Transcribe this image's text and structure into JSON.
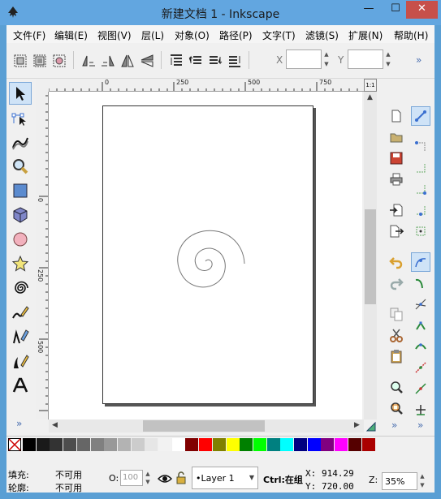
{
  "window": {
    "title": "新建文档 1 - Inkscape",
    "minimize": "—",
    "maximize": "☐",
    "close": "✕"
  },
  "menu": [
    {
      "label": "文件(F)"
    },
    {
      "label": "编辑(E)"
    },
    {
      "label": "视图(V)"
    },
    {
      "label": "层(L)"
    },
    {
      "label": "对象(O)"
    },
    {
      "label": "路径(P)"
    },
    {
      "label": "文字(T)"
    },
    {
      "label": "滤镜(S)"
    },
    {
      "label": "扩展(N)"
    },
    {
      "label": "帮助(H)"
    }
  ],
  "commands": {
    "x_label": "X",
    "y_label": "Y",
    "x_value": "",
    "y_value": "",
    "more": "»"
  },
  "ruler": {
    "top_ticks": [
      "0",
      "250",
      "500",
      "750"
    ],
    "left_ticks": [
      "0",
      "250",
      "500"
    ]
  },
  "zoom_corner": "1:1",
  "statusbar": {
    "fill_label": "填充:",
    "fill_value": "不可用",
    "stroke_label": "轮廓:",
    "stroke_value": "不可用",
    "opacity_label": "O:",
    "opacity_value": "100",
    "layer": "•Layer 1",
    "message": "Ctrl:在组",
    "x_label": "X:",
    "x_value": "914.29",
    "y_label": "Y:",
    "y_value": "720.00",
    "zoom_label": "Z:",
    "zoom_value": "35%"
  },
  "palette": [
    "#000000",
    "#1a1a1a",
    "#333333",
    "#4d4d4d",
    "#666666",
    "#808080",
    "#999999",
    "#b3b3b3",
    "#cccccc",
    "#e6e6e6",
    "#f2f2f2",
    "#ffffff",
    "#800000",
    "#ff0000",
    "#808000",
    "#ffff00",
    "#008000",
    "#00ff00",
    "#008080",
    "#00ffff",
    "#000080",
    "#0000ff",
    "#800080",
    "#ff00ff",
    "#550000",
    "#aa0000"
  ],
  "colors": {
    "titlebar": "#62a6e0",
    "close": "#c7504a",
    "accent": "#7aa7d8"
  }
}
